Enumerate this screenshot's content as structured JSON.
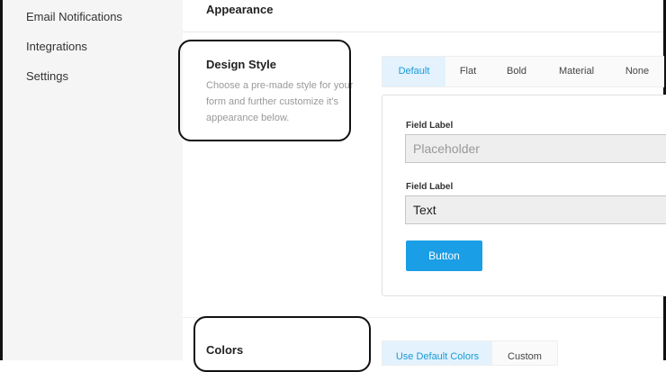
{
  "sidebar": {
    "items": [
      "Email Notifications",
      "Integrations",
      "Settings"
    ]
  },
  "main": {
    "section_title": "Appearance",
    "design_style": {
      "label": "Design Style",
      "description": "Choose a pre-made style for your form and further customize it's appearance below.",
      "tabs": [
        "Default",
        "Flat",
        "Bold",
        "Material",
        "None"
      ],
      "active_tab": "Default"
    },
    "preview": {
      "field1_label": "Field Label",
      "field1_placeholder": "Placeholder",
      "field2_label": "Field Label",
      "field2_value": "Text",
      "button_label": "Button"
    },
    "colors": {
      "label": "Colors",
      "tabs": [
        "Use Default Colors",
        "Custom"
      ],
      "active_tab": "Use Default Colors"
    }
  },
  "theme": {
    "accent": "#1a9ee6",
    "active_tab_bg": "#e3f2fd",
    "sidebar_bg": "#f5f5f5"
  }
}
